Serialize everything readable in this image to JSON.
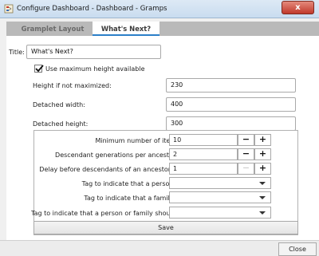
{
  "window": {
    "title": "Configure Dashboard - Dashboard - Gramps",
    "close_glyph": "x",
    "app_icon": "gramps-tree-icon"
  },
  "tabs": [
    {
      "label": "Gramplet Layout",
      "active": false
    },
    {
      "label": "What's Next?",
      "active": true
    }
  ],
  "form": {
    "title_label": "Title:",
    "title_value": "What's Next?",
    "use_max_height_label": "Use maximum height available",
    "use_max_height_checked": true,
    "height_label": "Height if not maximized:",
    "height_value": "230",
    "detached_width_label": "Detached width:",
    "detached_width_value": "400",
    "detached_height_label": "Detached height:",
    "detached_height_value": "300"
  },
  "options": {
    "min_items_label": "Minimum number of items to display:",
    "min_items_value": "10",
    "desc_gen_label": "Descendant generations per ancestor generation:",
    "desc_gen_value": "2",
    "delay_label": "Delay before descendants of an ancestor is processed:",
    "delay_value": "1",
    "tag_person_label": "Tag to indicate that a person is complete:",
    "tag_family_label": "Tag to indicate that a family is complete:",
    "tag_ignore_label": "Tag to indicate that a person or family should be ignored:",
    "minus_glyph": "−",
    "plus_glyph": "+"
  },
  "buttons": {
    "save_label": "Save",
    "close_label": "Close"
  },
  "colors": {
    "active_tab_underline": "#2b7fc8",
    "close_button": "#c1392b"
  }
}
